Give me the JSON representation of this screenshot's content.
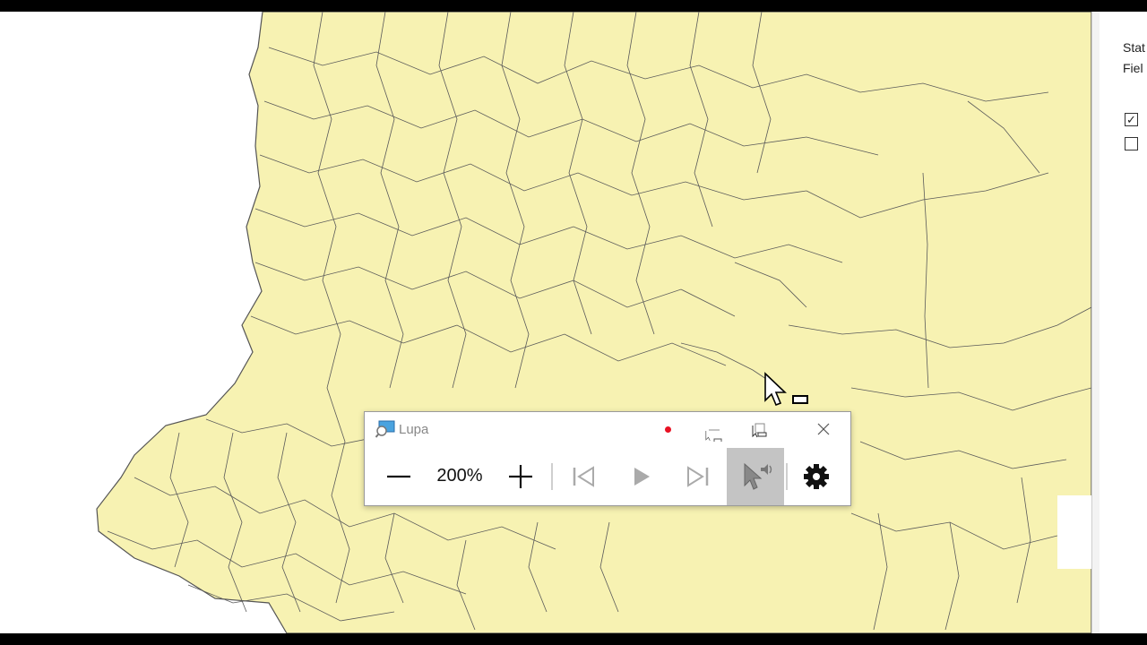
{
  "magnifier": {
    "title": "Lupa",
    "zoom_level": "200%"
  },
  "side_panel": {
    "label_1": "Stat",
    "label_2": "Fiel",
    "checkbox_1": {
      "checked": true,
      "mark": "✓"
    },
    "checkbox_2": {
      "checked": false
    }
  },
  "colors": {
    "map_fill": "#f7f2b2",
    "map_border": "#545454",
    "recording_dot": "#e81123",
    "selected_button_bg": "#c4c4c4"
  }
}
